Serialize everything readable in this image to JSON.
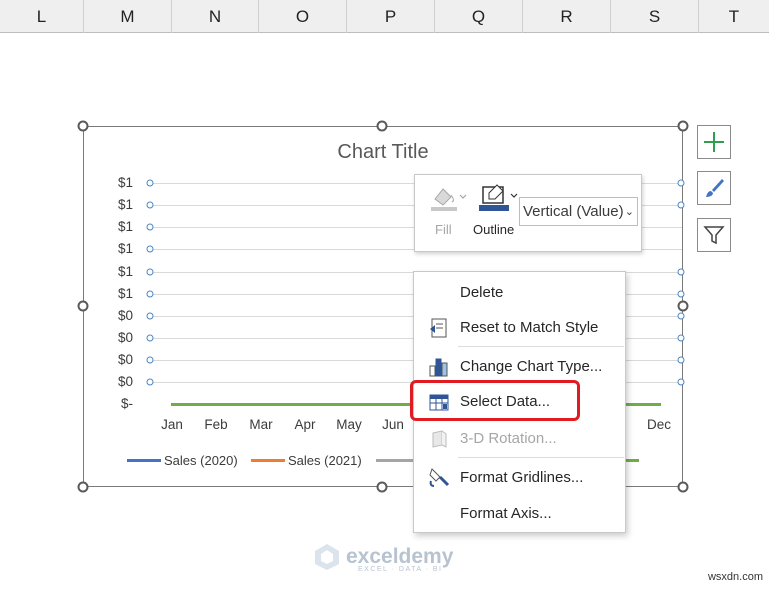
{
  "columns": [
    "L",
    "M",
    "N",
    "O",
    "P",
    "Q",
    "R",
    "S",
    "T"
  ],
  "chart": {
    "title": "Chart Title",
    "y_tick_labels": [
      "$1",
      "$1",
      "$1",
      "$1",
      "$1",
      "$1",
      "$0",
      "$0",
      "$0",
      "$0",
      "$-"
    ],
    "x_tick_labels": [
      "Jan",
      "Feb",
      "Mar",
      "Apr",
      "May",
      "Jun",
      "Dec"
    ],
    "legend": [
      {
        "label": "Sales (2020)",
        "color": "#4472c4"
      },
      {
        "label": "Sales (2021)",
        "color": "#ed7d31"
      }
    ]
  },
  "chart_data": {
    "type": "line",
    "title": "Chart Title",
    "categories": [
      "Jan",
      "Feb",
      "Mar",
      "Apr",
      "May",
      "Jun",
      "Dec"
    ],
    "y_tick_labels": [
      "$1",
      "$1",
      "$1",
      "$1",
      "$1",
      "$1",
      "$0",
      "$0",
      "$0",
      "$0",
      "$-"
    ],
    "series": [
      {
        "name": "Sales (2020)",
        "color": "#4472c4"
      },
      {
        "name": "Sales (2021)",
        "color": "#ed7d31"
      }
    ],
    "grid": true,
    "legend_position": "bottom"
  },
  "mini_toolbar": {
    "fill_label": "Fill",
    "outline_label": "Outline",
    "element_select": "Vertical (Value)"
  },
  "context_menu": {
    "items": [
      {
        "label": "Delete",
        "icon": "none",
        "enabled": true
      },
      {
        "label": "Reset to Match Style",
        "icon": "reset-style-icon",
        "enabled": true
      },
      {
        "label": "Change Chart Type...",
        "icon": "chart-type-icon",
        "enabled": true
      },
      {
        "label": "Select Data...",
        "icon": "select-data-icon",
        "enabled": true
      },
      {
        "label": "3-D Rotation...",
        "icon": "3d-rotation-icon",
        "enabled": false
      },
      {
        "label": "Format Gridlines...",
        "icon": "format-icon",
        "enabled": true
      },
      {
        "label": "Format Axis...",
        "icon": "none",
        "enabled": true
      }
    ],
    "highlighted": "Select Data..."
  },
  "side_buttons": [
    "chart-elements-icon",
    "chart-styles-icon",
    "chart-filters-icon"
  ],
  "watermark": {
    "name": "exceldemy",
    "tagline": "EXCEL · DATA · BI"
  },
  "site": "wsxdn.com",
  "colors": {
    "accent_green": "#70ad47",
    "highlight_red": "#e11b22",
    "series_blue": "#4472c4",
    "series_orange": "#ed7d31"
  }
}
